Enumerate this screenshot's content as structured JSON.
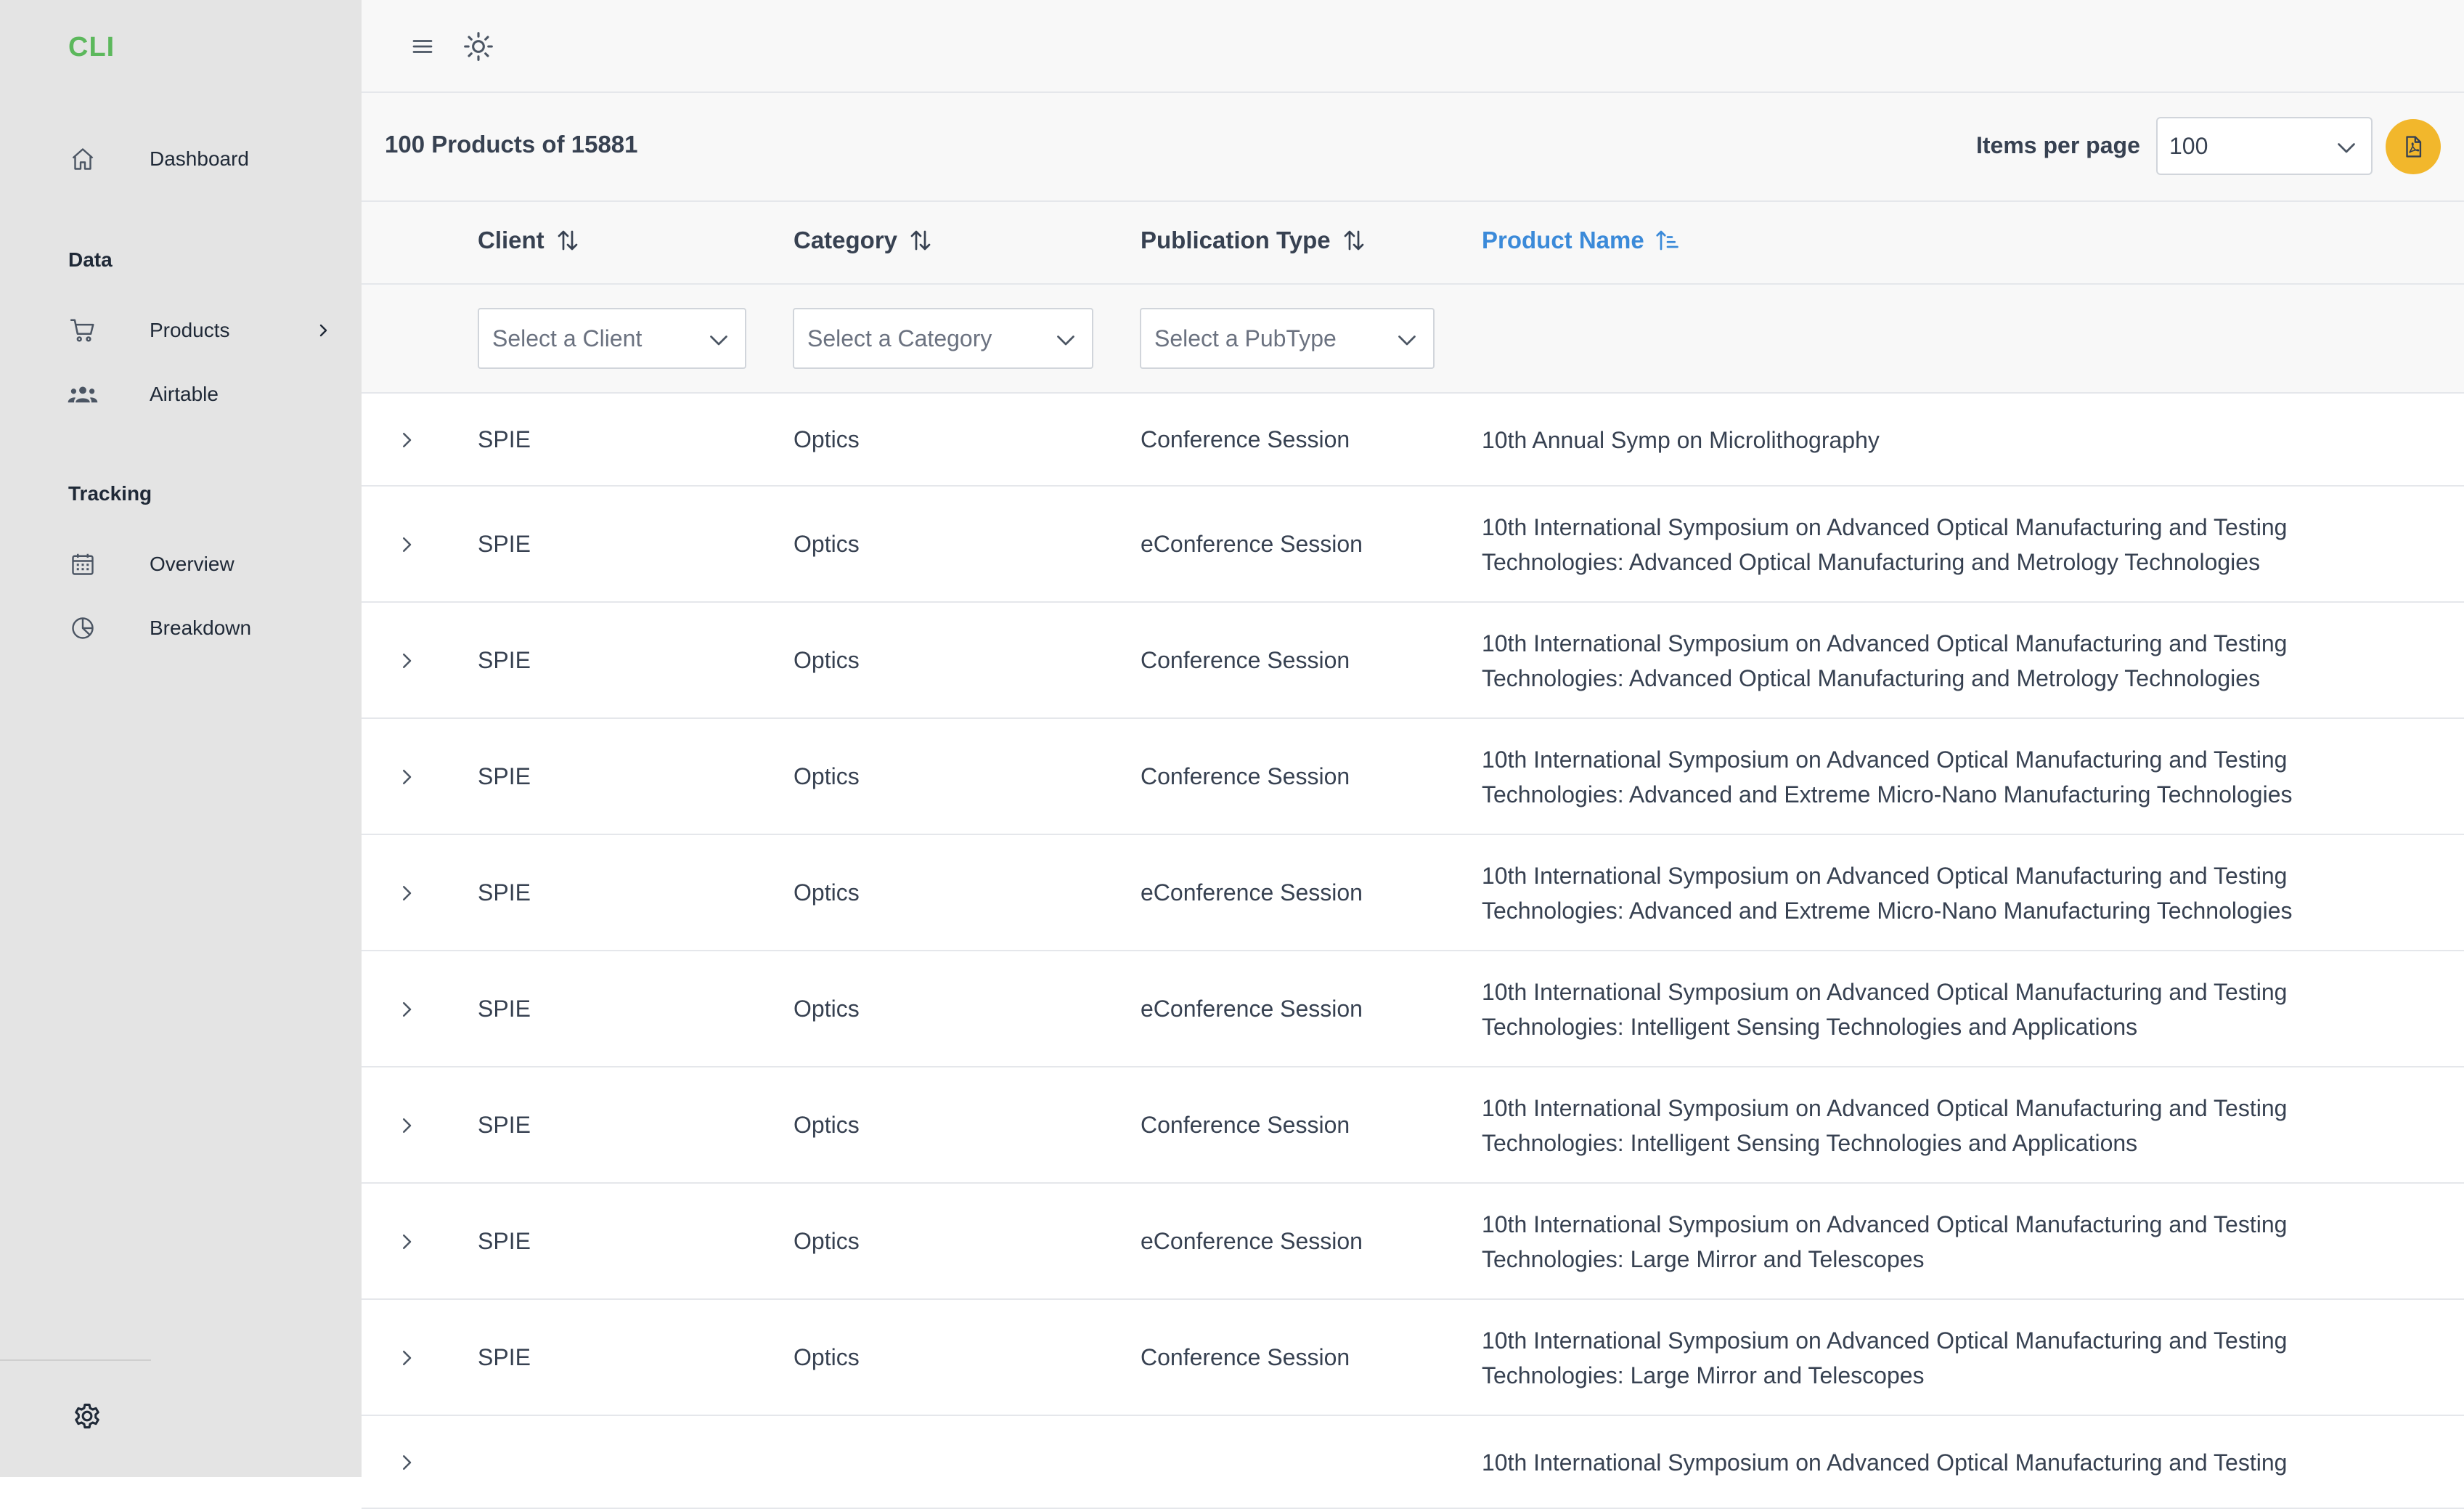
{
  "app": {
    "logo": "CLI",
    "colors": {
      "accent": "#3b8ad9",
      "logo": "#5cb85c",
      "pdf_button": "#f2b72c",
      "sidebar_bg": "#e4e4e4"
    }
  },
  "sidebar": {
    "dashboard": {
      "label": "Dashboard",
      "icon": "home-icon"
    },
    "data_section": "Data",
    "products": {
      "label": "Products",
      "icon": "cart-icon"
    },
    "airtable": {
      "label": "Airtable",
      "icon": "users-icon"
    },
    "tracking_section": "Tracking",
    "overview": {
      "label": "Overview",
      "icon": "calendar-icon"
    },
    "breakdown": {
      "label": "Breakdown",
      "icon": "pie-chart-icon"
    },
    "settings_icon": "gear-icon"
  },
  "topbar": {
    "menu_icon": "hamburger-icon",
    "theme_icon": "sun-icon"
  },
  "toolbar": {
    "count_text": "100 Products of 15881",
    "items_per_page_label": "Items per page",
    "items_per_page_value": "100",
    "export_icon": "pdf-icon"
  },
  "table": {
    "columns": [
      {
        "label": "Client",
        "sort": "sortable"
      },
      {
        "label": "Category",
        "sort": "sortable"
      },
      {
        "label": "Publication Type",
        "sort": "sortable"
      },
      {
        "label": "Product Name",
        "sort": "ascending"
      }
    ],
    "filters": {
      "client_placeholder": "Select a Client",
      "category_placeholder": "Select a Category",
      "pubtype_placeholder": "Select a PubType"
    },
    "rows": [
      {
        "client": "SPIE",
        "category": "Optics",
        "pubtype": "Conference Session",
        "name": [
          "10th Annual Symp on Microlithography"
        ]
      },
      {
        "client": "SPIE",
        "category": "Optics",
        "pubtype": "eConference Session",
        "name": [
          "10th International Symposium on Advanced Optical Manufacturing and Testing",
          "Technologies: Advanced Optical Manufacturing and Metrology Technologies"
        ]
      },
      {
        "client": "SPIE",
        "category": "Optics",
        "pubtype": "Conference Session",
        "name": [
          "10th International Symposium on Advanced Optical Manufacturing and Testing",
          "Technologies: Advanced Optical Manufacturing and Metrology Technologies"
        ]
      },
      {
        "client": "SPIE",
        "category": "Optics",
        "pubtype": "Conference Session",
        "name": [
          "10th International Symposium on Advanced Optical Manufacturing and Testing",
          "Technologies: Advanced and Extreme Micro-Nano Manufacturing Technologies"
        ]
      },
      {
        "client": "SPIE",
        "category": "Optics",
        "pubtype": "eConference Session",
        "name": [
          "10th International Symposium on Advanced Optical Manufacturing and Testing",
          "Technologies: Advanced and Extreme Micro-Nano Manufacturing Technologies"
        ]
      },
      {
        "client": "SPIE",
        "category": "Optics",
        "pubtype": "eConference Session",
        "name": [
          "10th International Symposium on Advanced Optical Manufacturing and Testing",
          "Technologies: Intelligent Sensing Technologies and Applications"
        ]
      },
      {
        "client": "SPIE",
        "category": "Optics",
        "pubtype": "Conference Session",
        "name": [
          "10th International Symposium on Advanced Optical Manufacturing and Testing",
          "Technologies: Intelligent Sensing Technologies and Applications"
        ]
      },
      {
        "client": "SPIE",
        "category": "Optics",
        "pubtype": "eConference Session",
        "name": [
          "10th International Symposium on Advanced Optical Manufacturing and Testing",
          "Technologies: Large Mirror and Telescopes"
        ]
      },
      {
        "client": "SPIE",
        "category": "Optics",
        "pubtype": "Conference Session",
        "name": [
          "10th International Symposium on Advanced Optical Manufacturing and Testing",
          "Technologies: Large Mirror and Telescopes"
        ]
      },
      {
        "client": "",
        "category": "",
        "pubtype": "",
        "name": [
          "10th International Symposium on Advanced Optical Manufacturing and Testing"
        ]
      }
    ]
  }
}
